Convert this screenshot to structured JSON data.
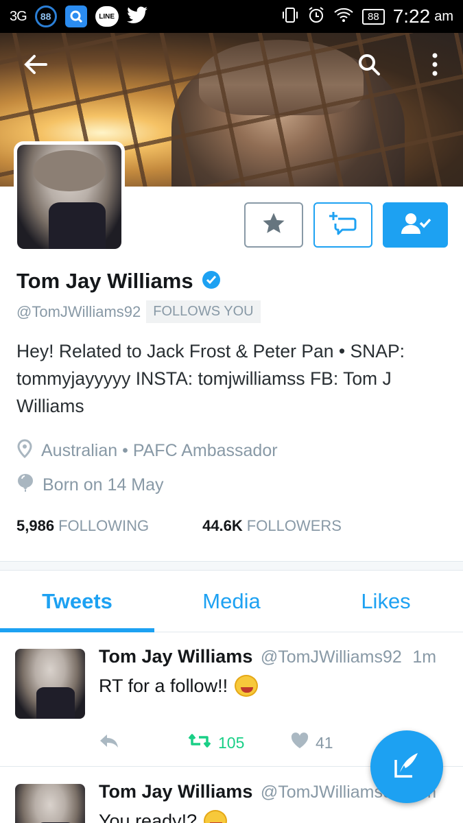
{
  "status_bar": {
    "network": "3G",
    "badge_count": "88",
    "line_label": "LINE",
    "battery": "88",
    "time": "7:22",
    "ampm": "am"
  },
  "icons": {
    "back": "arrow-left-icon",
    "search": "search-icon",
    "overflow": "more-vertical-icon",
    "star": "star-icon",
    "dm": "message-plus-icon",
    "follow": "person-check-icon",
    "location": "location-pin-icon",
    "birthday": "balloon-icon",
    "verified": "verified-badge-icon",
    "reply": "reply-icon",
    "retweet": "retweet-icon",
    "like": "heart-icon",
    "compose": "compose-feather-icon"
  },
  "colors": {
    "accent": "#1da1f2",
    "retweet": "#19cf86",
    "muted": "#8899a6"
  },
  "profile": {
    "name": "Tom Jay Williams",
    "handle": "@TomJWilliams92",
    "follows_you": "FOLLOWS YOU",
    "bio": "Hey!  Related to Jack Frost & Peter Pan • SNAP: tommyjayyyyy INSTA: tomjwilliamss FB: Tom J Williams",
    "location": "Australian • PAFC Ambassador",
    "born": "Born on 14 May",
    "following_count": "5,986",
    "following_label": "FOLLOWING",
    "followers_count": "44.6K",
    "followers_label": "FOLLOWERS"
  },
  "tabs": [
    {
      "label": "Tweets",
      "active": true
    },
    {
      "label": "Media",
      "active": false
    },
    {
      "label": "Likes",
      "active": false
    }
  ],
  "tweets": [
    {
      "name": "Tom Jay Williams",
      "handle": "@TomJWilliams92",
      "time": "1m",
      "text": "RT for a follow!!",
      "retweets": "105",
      "likes": "41"
    },
    {
      "name": "Tom Jay Williams",
      "handle": "@TomJWilliams92",
      "time": "4m",
      "text": "You ready!?"
    }
  ]
}
